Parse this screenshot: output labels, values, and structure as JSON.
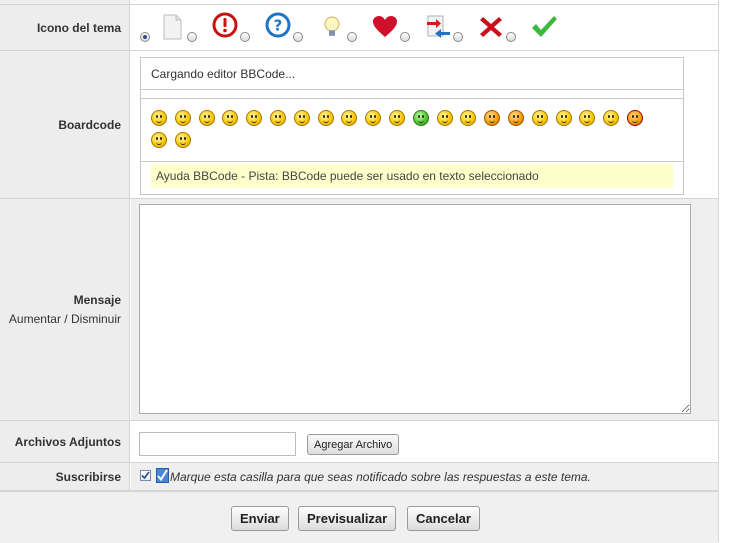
{
  "form": {
    "topic_icon_label": "Icono del tema",
    "boardcode_label": "Boardcode",
    "message_label": "Mensaje",
    "increase_label": "Aumentar",
    "size_separator": "/",
    "decrease_label": "Disminuir",
    "attachments_label": "Archivos Adjuntos",
    "subscribe_label": "Suscribirse"
  },
  "icons": [
    {
      "name": "no-icon",
      "selected": true
    },
    {
      "name": "document-icon",
      "selected": false
    },
    {
      "name": "exclamation-icon",
      "selected": false
    },
    {
      "name": "question-icon",
      "selected": false
    },
    {
      "name": "lightbulb-icon",
      "selected": false
    },
    {
      "name": "heart-icon",
      "selected": false
    },
    {
      "name": "transfer-icon",
      "selected": false
    },
    {
      "name": "red-x-icon",
      "selected": false
    },
    {
      "name": "checkmark-icon",
      "selected": false
    }
  ],
  "editor": {
    "loading_text": "Cargando editor BBCode...",
    "help_text": "Ayuda BBCode - Pista: BBCode puede ser usado en texto seleccionado",
    "smiley_count": 23
  },
  "message": {
    "value": ""
  },
  "attachments": {
    "value": "",
    "add_button": "Agregar Archivo"
  },
  "subscribe": {
    "checked": true,
    "note": "Marque esta casilla para que seas notificado sobre las respuestas a este tema."
  },
  "buttons": {
    "send": "Enviar",
    "preview": "Previsualizar",
    "cancel": "Cancelar"
  }
}
